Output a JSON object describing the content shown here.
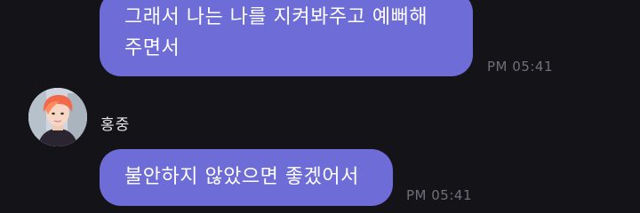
{
  "messages": [
    {
      "text_line1": "그래서 나는 나를 지켜봐주고 예뻐해",
      "text_line2": "주면서",
      "time": "PM 05:41"
    },
    {
      "sender": "홍중",
      "text": "불안하지 않았으면 좋겠어서",
      "time": "PM 05:41"
    }
  ],
  "colors": {
    "background": "#141418",
    "bubble": "#6e6cd6",
    "timestamp": "#6e6f7a"
  },
  "avatar": {
    "icon": "profile-photo-avatar"
  }
}
